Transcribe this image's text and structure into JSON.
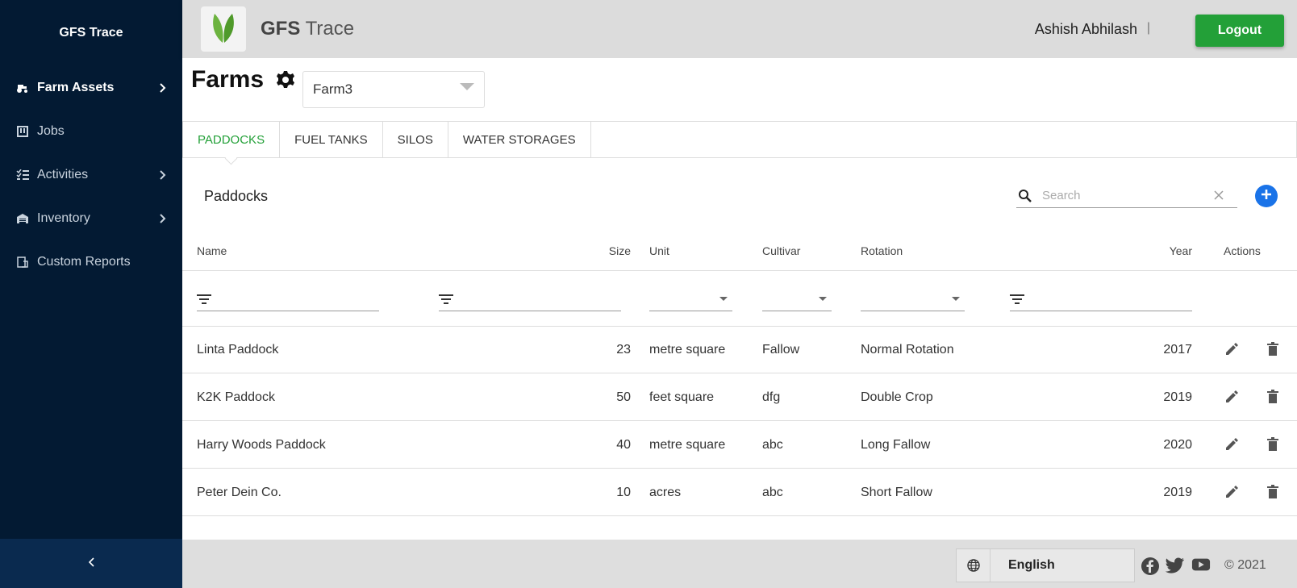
{
  "sidebar": {
    "brand": "GFS Trace",
    "items": [
      {
        "label": "Farm Assets",
        "icon": "tractor-icon",
        "has_children": true,
        "active": true
      },
      {
        "label": "Jobs",
        "icon": "jobs-icon",
        "has_children": false,
        "active": false
      },
      {
        "label": "Activities",
        "icon": "checklist-icon",
        "has_children": true,
        "active": false
      },
      {
        "label": "Inventory",
        "icon": "warehouse-icon",
        "has_children": true,
        "active": false
      },
      {
        "label": "Custom Reports",
        "icon": "report-icon",
        "has_children": false,
        "active": false
      }
    ],
    "collapse_icon": "chevron-left-icon"
  },
  "header": {
    "app_title_bold": "GFS",
    "app_title_rest": " Trace",
    "logo_icon": "leaf-icon",
    "user_name": "Ashish Abhilash",
    "separator": "|",
    "logout_label": "Logout"
  },
  "page": {
    "title": "Farms",
    "settings_icon": "gear-icon",
    "farm_select_value": "Farm3"
  },
  "tabs": [
    {
      "label": "PADDOCKS",
      "active": true
    },
    {
      "label": "FUEL TANKS",
      "active": false
    },
    {
      "label": "SILOS",
      "active": false
    },
    {
      "label": "WATER STORAGES",
      "active": false
    }
  ],
  "panel": {
    "title": "Paddocks",
    "search_placeholder": "Search"
  },
  "table": {
    "columns": [
      "Name",
      "Size",
      "Unit",
      "Cultivar",
      "Rotation",
      "Year",
      "Actions"
    ],
    "rows": [
      {
        "name": "Linta Paddock",
        "size": "23",
        "unit": "metre square",
        "cultivar": "Fallow",
        "rotation": "Normal Rotation",
        "year": "2017"
      },
      {
        "name": "K2K Paddock",
        "size": "50",
        "unit": "feet square",
        "cultivar": "dfg",
        "rotation": "Double Crop",
        "year": "2019"
      },
      {
        "name": "Harry Woods Paddock",
        "size": "40",
        "unit": "metre square",
        "cultivar": "abc",
        "rotation": "Long Fallow",
        "year": "2020"
      },
      {
        "name": "Peter Dein Co.",
        "size": "10",
        "unit": "acres",
        "cultivar": "abc",
        "rotation": "Short Fallow",
        "year": "2019"
      }
    ]
  },
  "footer": {
    "language": "English",
    "copyright": "© 2021",
    "social": [
      "facebook-icon",
      "twitter-icon",
      "youtube-icon"
    ]
  },
  "colors": {
    "sidebar_bg": "#031a33",
    "accent_green": "#23a038",
    "add_blue": "#1a73e8"
  }
}
